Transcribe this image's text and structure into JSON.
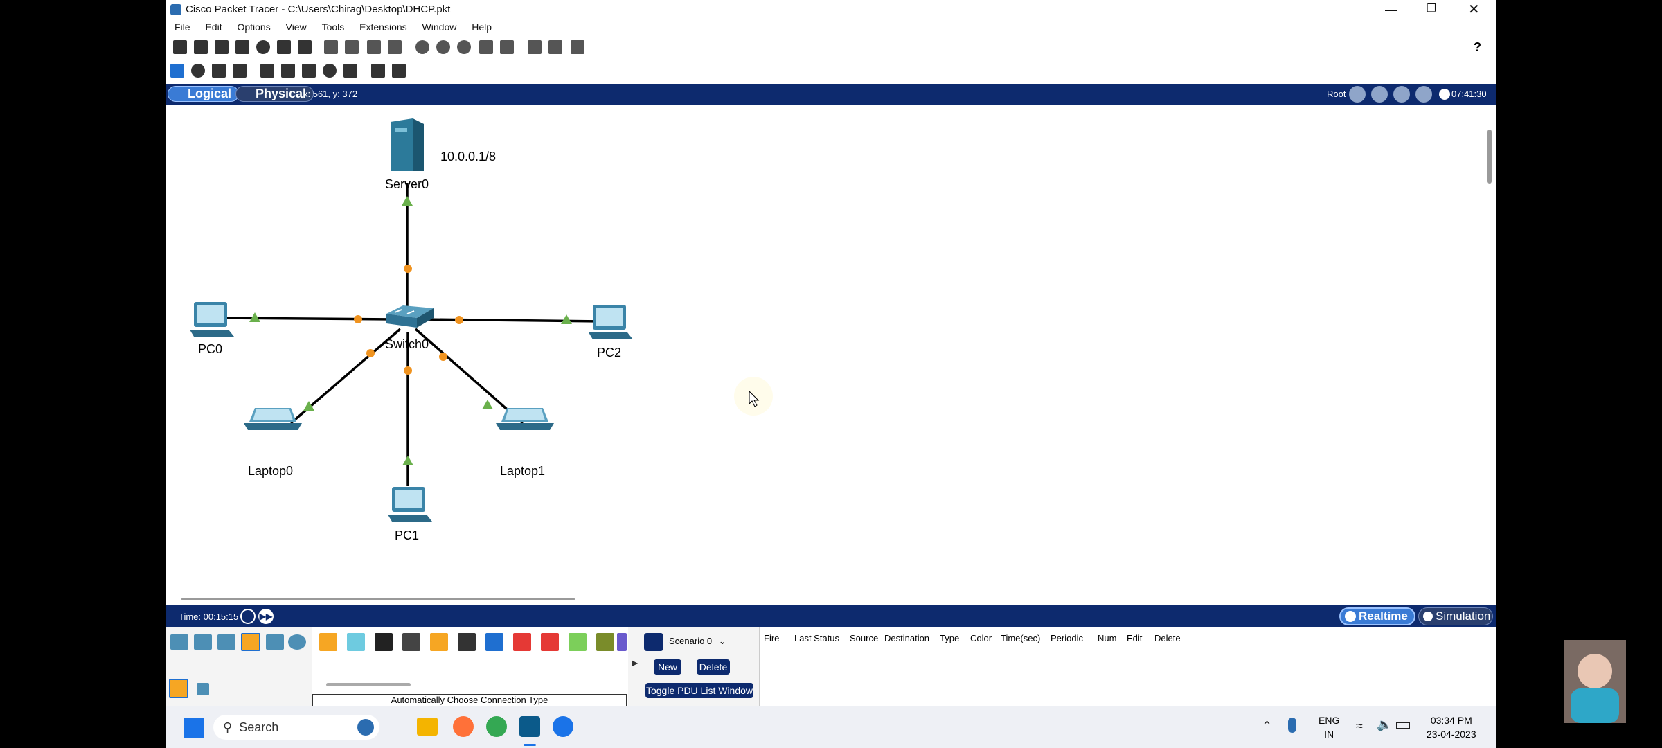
{
  "window": {
    "title": "Cisco Packet Tracer - C:\\Users\\Chirag\\Desktop\\DHCP.pkt"
  },
  "menu": [
    "File",
    "Edit",
    "Options",
    "View",
    "Tools",
    "Extensions",
    "Window",
    "Help"
  ],
  "modebar": {
    "logical": "Logical",
    "physical": "Physical",
    "coords": "x: 561, y: 372",
    "root": "Root",
    "clock": "07:41:30"
  },
  "devices": {
    "server": "Server0",
    "server_ip": "10.0.0.1/8",
    "switch": "Switch0",
    "pc0": "PC0",
    "pc1": "PC1",
    "pc2": "PC2",
    "laptop0": "Laptop0",
    "laptop1": "Laptop1"
  },
  "status": {
    "time": "Time: 00:15:15",
    "realtime": "Realtime",
    "simulation": "Simulation"
  },
  "bottom": {
    "connection_type": "Automatically Choose Connection Type",
    "scenario": "Scenario 0",
    "new": "New",
    "delete": "Delete",
    "toggle": "Toggle PDU List Window",
    "columns": [
      "Fire",
      "Last Status",
      "Source",
      "Destination",
      "Type",
      "Color",
      "Time(sec)",
      "Periodic",
      "Num",
      "Edit",
      "Delete"
    ]
  },
  "taskbar": {
    "search": "Search",
    "lang1": "ENG",
    "lang2": "IN",
    "time": "03:34 PM",
    "date": "23-04-2023"
  },
  "colors": {
    "accent": "#0d2a6e",
    "link": "#000000",
    "port_up": "#6ab04c",
    "port_wait": "#f0931f"
  }
}
